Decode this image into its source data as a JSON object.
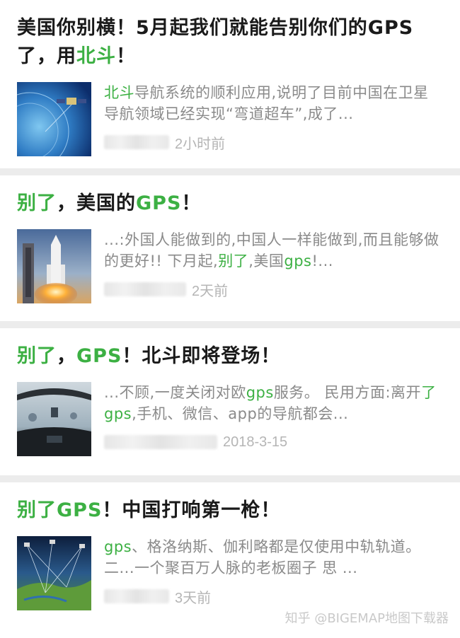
{
  "articles": [
    {
      "title_parts": [
        "美国你别横！5月起我们就能告别你们的GPS了，用",
        "北斗",
        "！"
      ],
      "snippet_parts": [
        "北斗",
        "导航系统的顺利应用,说明了目前中国在卫星导航领域已经实现“弯道超车”,成了..."
      ],
      "time": "2小时前",
      "thumb_icon": "satellite-earth-image"
    },
    {
      "title_parts": [
        "别了",
        "，美国的",
        "GPS",
        "！"
      ],
      "snippet_parts": [
        "...:外国人能做到的,中国人一样能做到,而且能够做的更好!! 下月起,",
        "别了",
        ",美国",
        "gps",
        "!..."
      ],
      "time": "2天前",
      "thumb_icon": "rocket-launch-image"
    },
    {
      "title_parts": [
        "别了",
        "，",
        "GPS",
        "！北斗即将登场！"
      ],
      "snippet_parts": [
        "...不顾,一度关闭对欧",
        "gps",
        "服务。 民用方面:离开",
        "了gps",
        ",手机、微信、app的导航都会..."
      ],
      "time": "2018-3-15",
      "thumb_icon": "car-dashboard-image"
    },
    {
      "title_parts": [
        "别了GPS",
        "！中国打响第一枪！"
      ],
      "snippet_parts": [
        "gps",
        "、格洛纳斯、伽利略都是仅使用中轨轨道。 二...一个聚百万人脉的老板圈子 思 ..."
      ],
      "time": "3天前",
      "thumb_icon": "satellite-network-map-image"
    }
  ],
  "watermark": "知乎 @BIGEMAP地图下载器",
  "colors": {
    "highlight": "#3cb043",
    "snippet": "#8a8a8a",
    "time": "#b5b5b5",
    "separator": "#ececec"
  }
}
